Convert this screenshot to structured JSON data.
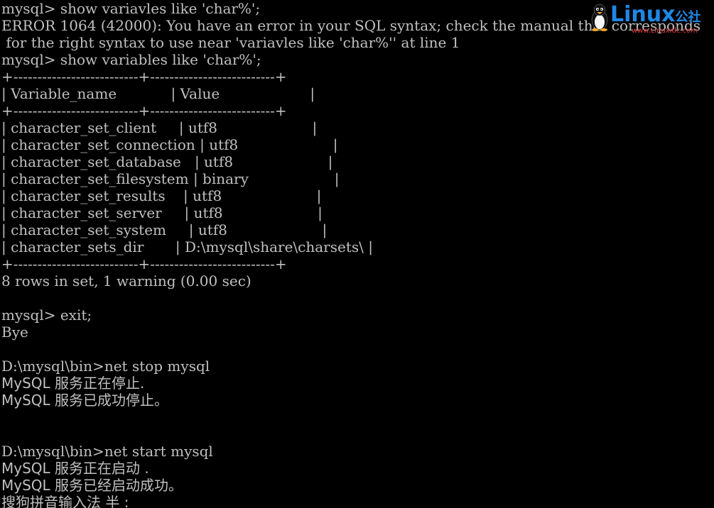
{
  "terminal": {
    "lines": [
      "mysql> show variavles like 'char%';",
      "ERROR 1064 (42000): You have an error in your SQL syntax; check the manual that corresponds",
      " for the right syntax to use near 'variavles like 'char%'' at line 1",
      "mysql> show variables like 'char%';",
      "+--------------------------+--------------------------+",
      "| Variable_name            | Value                    |",
      "+--------------------------+--------------------------+",
      "| character_set_client     | utf8                     |",
      "| character_set_connection | utf8                     |",
      "| character_set_database   | utf8                     |",
      "| character_set_filesystem | binary                   |",
      "| character_set_results    | utf8                     |",
      "| character_set_server     | utf8                     |",
      "| character_set_system     | utf8                     |",
      "| character_sets_dir       | D:\\mysql\\share\\charsets\\ |",
      "+--------------------------+--------------------------+",
      "8 rows in set, 1 warning (0.00 sec)",
      "",
      "mysql> exit;",
      "Bye",
      "",
      "D:\\mysql\\bin>net stop mysql",
      "MySQL 服务正在停止.",
      "MySQL 服务已成功停止。",
      "",
      "",
      "D:\\mysql\\bin>net start mysql",
      "MySQL 服务正在启动 .",
      "MySQL 服务已经启动成功。",
      "搜狗拼音输入法 半 :"
    ]
  },
  "watermark": {
    "brand": "Linux",
    "suffix": "公社",
    "url": "www.Linuxidc.com",
    "brand_color": "#1e88e5",
    "url_color": "#e53935"
  },
  "colors": {
    "background": "#000000",
    "text": "#c0c0c0"
  }
}
